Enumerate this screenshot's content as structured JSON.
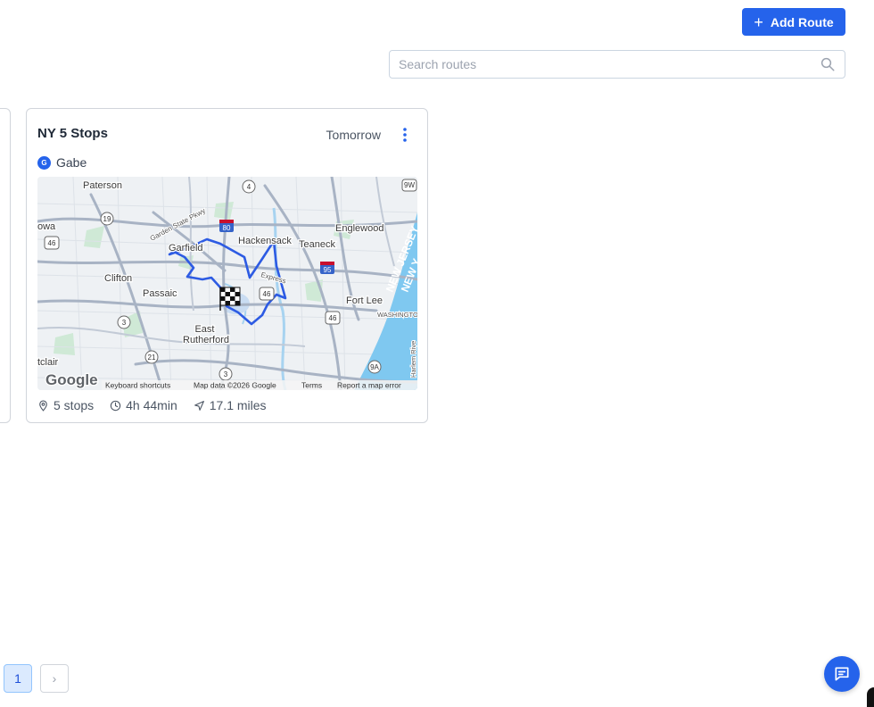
{
  "toolbar": {
    "add_route_label": "Add Route"
  },
  "search": {
    "placeholder": "Search routes",
    "value": ""
  },
  "route_card": {
    "title": "NY 5 Stops",
    "date": "Tomorrow",
    "driver": {
      "initial": "G",
      "name": "Gabe"
    },
    "stats": {
      "stops": "5 stops",
      "duration": "4h 44min",
      "distance": "17.1 miles"
    },
    "map": {
      "places": [
        "Paterson",
        "Garfield",
        "Hackensack",
        "Teaneck",
        "Englewood",
        "Clifton",
        "Passaic",
        "Fort Lee",
        "East Rutherford",
        "tclair",
        "owa"
      ],
      "highway_labels": [
        "4",
        "19",
        "46",
        "80",
        "95",
        "46",
        "46",
        "3",
        "21",
        "3",
        "9A",
        "9W"
      ],
      "road_labels": [
        "Garden State Pkwy",
        "Express"
      ],
      "water_labels": [
        "NEW JERSEY",
        "NEW Y",
        "WASHINGTON HEIGH",
        "Harlem Rive"
      ],
      "attribution": {
        "logo": "Google",
        "keyboard": "Keyboard shortcuts",
        "data": "Map data ©2026 Google",
        "terms": "Terms",
        "report": "Report a map error"
      }
    }
  },
  "pagination": {
    "current": "1",
    "next_symbol": "›"
  },
  "colors": {
    "accent": "#2563eb",
    "route_line": "#2d5be3"
  },
  "icons": [
    "plus-icon",
    "search-icon",
    "kebab-icon",
    "pin-icon",
    "clock-icon",
    "navigation-icon",
    "chevron-right-icon",
    "chat-icon",
    "checkered-flag-icon"
  ]
}
